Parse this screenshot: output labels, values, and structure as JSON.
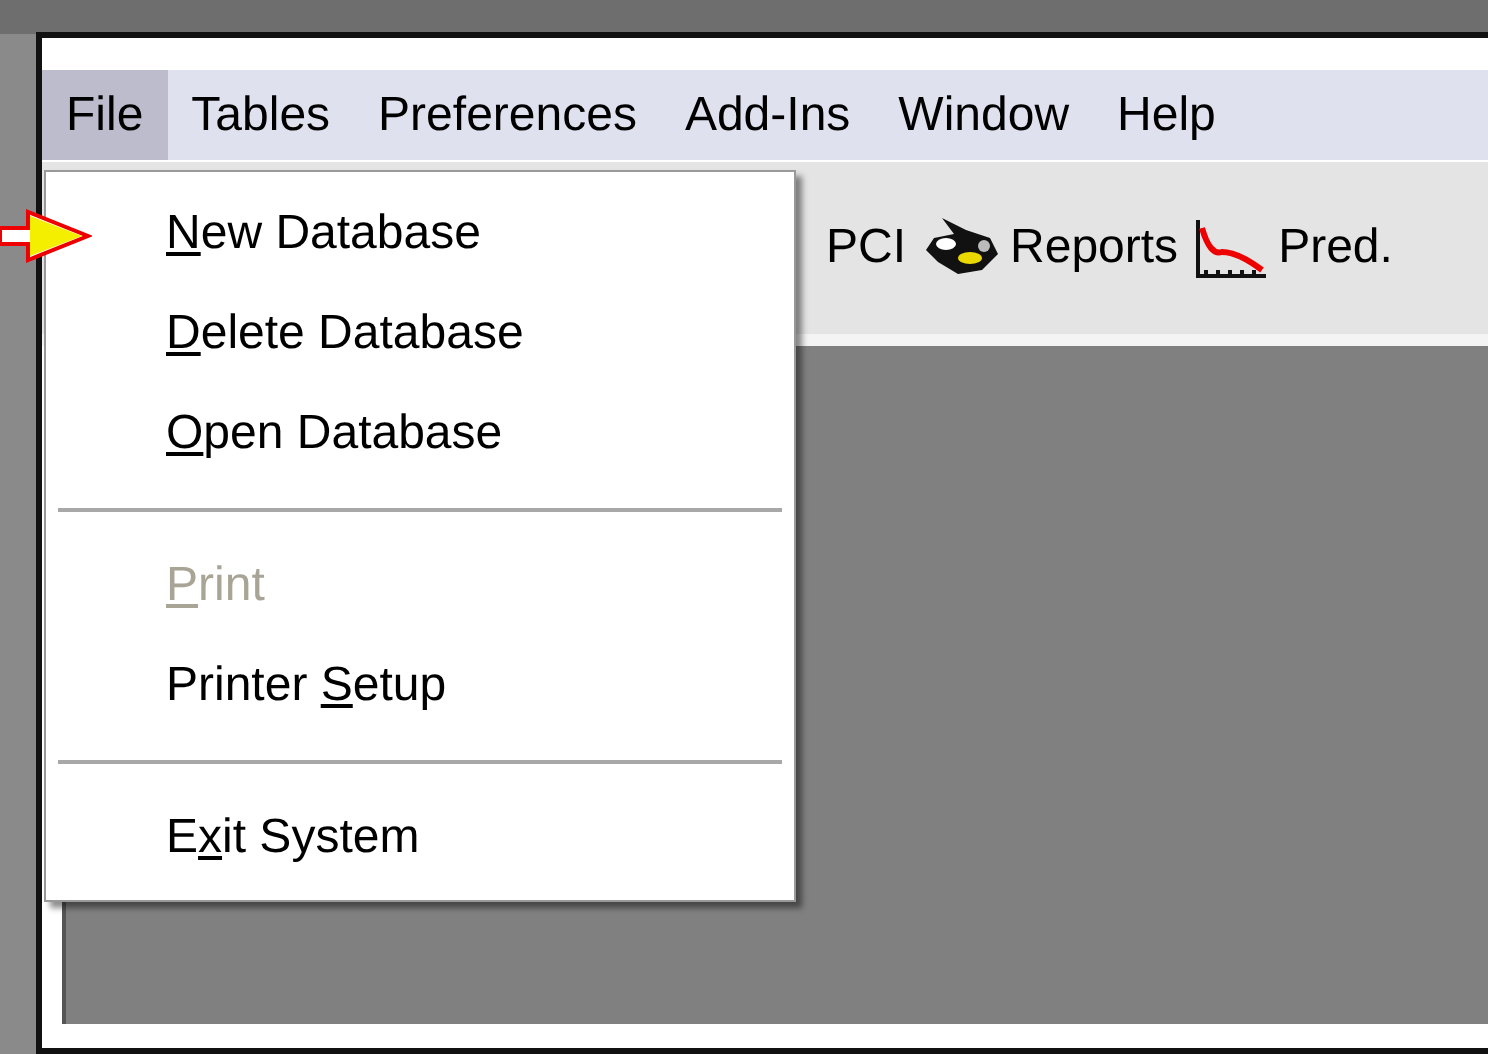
{
  "menu_bar": [
    {
      "label": "File",
      "selected": true
    },
    {
      "label": "Tables",
      "selected": false
    },
    {
      "label": "Preferences",
      "selected": false
    },
    {
      "label": "Add-Ins",
      "selected": false
    },
    {
      "label": "Window",
      "selected": false
    },
    {
      "label": "Help",
      "selected": false
    }
  ],
  "toolbar": [
    {
      "label": "PCI",
      "kind": "pci"
    },
    {
      "label": "Reports",
      "kind": "reports"
    },
    {
      "label": "Pred.",
      "kind": "prediction"
    }
  ],
  "file_menu": [
    {
      "kind": "item",
      "key": "N",
      "suffix": "ew Database",
      "disabled": false,
      "pointed": true
    },
    {
      "kind": "item",
      "key": "D",
      "suffix": "elete Database",
      "disabled": false,
      "pointed": false
    },
    {
      "kind": "item",
      "key": "O",
      "suffix": "pen Database",
      "disabled": false,
      "pointed": false
    },
    {
      "kind": "separator"
    },
    {
      "kind": "item",
      "key": "P",
      "suffix": "rint",
      "disabled": true,
      "pointed": false
    },
    {
      "kind": "item",
      "prefix": "Printer ",
      "key": "S",
      "suffix": "etup",
      "disabled": false,
      "pointed": false
    },
    {
      "kind": "separator"
    },
    {
      "kind": "item",
      "prefix": "E",
      "key": "x",
      "suffix": "it System",
      "disabled": false,
      "pointed": false
    }
  ]
}
